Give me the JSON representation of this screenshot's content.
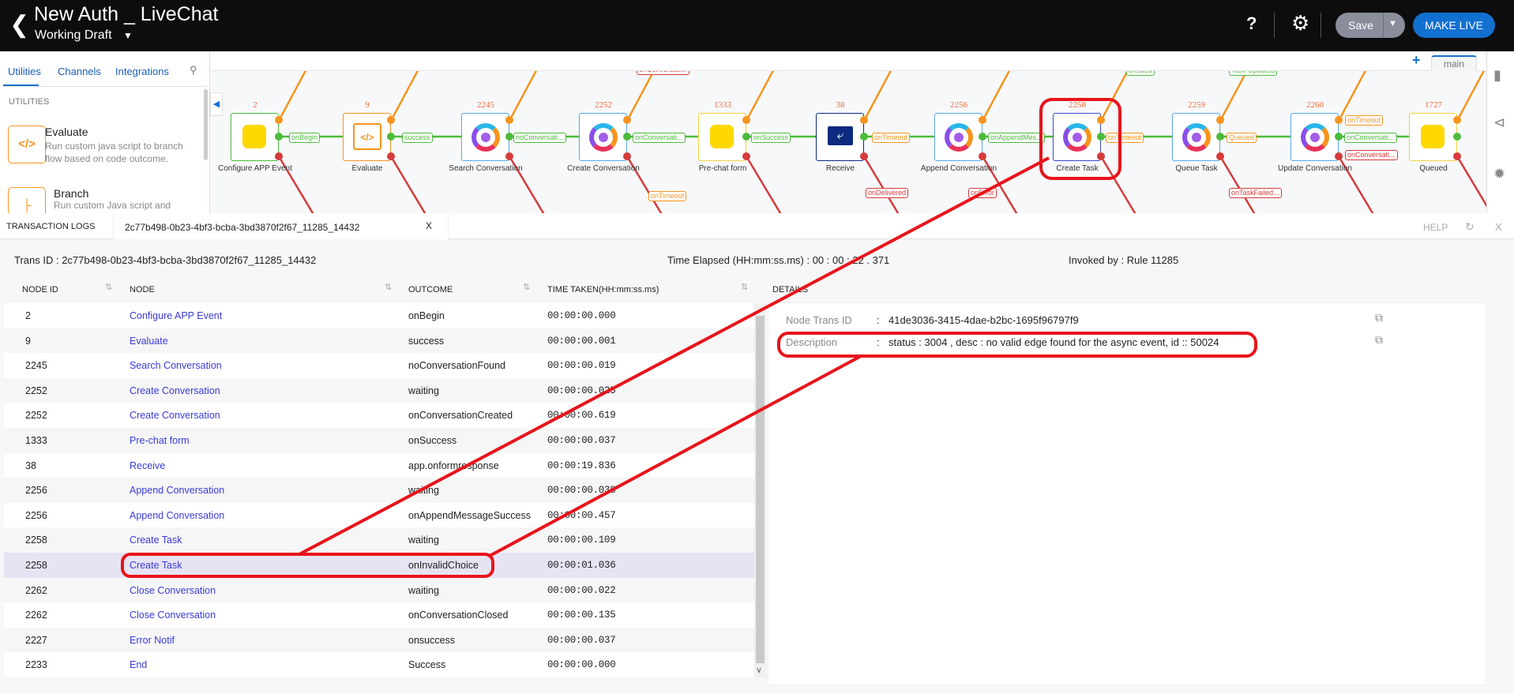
{
  "header": {
    "title": "New Auth _ LiveChat",
    "draft": "Working Draft",
    "save": "Save",
    "make_live": "MAKE LIVE",
    "help": "?"
  },
  "left_panel": {
    "tabs": [
      "Utilities",
      "Channels",
      "Integrations"
    ],
    "section": "UTILITIES",
    "items": [
      {
        "title": "Evaluate",
        "desc": "Run custom java script to branch flow based on code outcome.",
        "icon": "code-icon"
      },
      {
        "title": "Branch",
        "desc": "Run custom Java script and",
        "icon": "branch-icon"
      }
    ]
  },
  "canvas": {
    "tab": "main",
    "nodes": [
      {
        "id": "2",
        "label": "Configure APP Event",
        "type": "yellow",
        "border": "#4cbb3a"
      },
      {
        "id": "9",
        "label": "Evaluate",
        "type": "code",
        "border": "#f7941d"
      },
      {
        "id": "2245",
        "label": "Search Conversation",
        "type": "logo",
        "border": "#5aa9e6"
      },
      {
        "id": "2252",
        "label": "Create Conversation",
        "type": "logo",
        "border": "#5aa9e6"
      },
      {
        "id": "1333",
        "label": "Pre-chat form",
        "type": "yellow",
        "border": "#f5d33f"
      },
      {
        "id": "38",
        "label": "Receive",
        "type": "receive",
        "border": "#0b2a80"
      },
      {
        "id": "2256",
        "label": "Append Conversation",
        "type": "logo",
        "border": "#5aa9e6"
      },
      {
        "id": "2258",
        "label": "Create Task",
        "type": "logo",
        "border": "#3a4bd0"
      },
      {
        "id": "2259",
        "label": "Queue Task",
        "type": "logo",
        "border": "#5aa9e6"
      },
      {
        "id": "2260",
        "label": "Update Conversation",
        "type": "logo",
        "border": "#5aa9e6"
      },
      {
        "id": "1727",
        "label": "Queued",
        "type": "yellow",
        "border": "#f5d33f"
      }
    ],
    "edge_labels": [
      "onBegin",
      "success",
      "noConversati...",
      "onConversati...",
      "onSuccess",
      "onTimeout",
      "onAppendMes...",
      "onTimeout",
      "Queued",
      "onConversati...",
      "onTimeout",
      "onConversati...",
      "onConversati...",
      "created",
      "Task Updated",
      "onTimeout",
      "onDelivered",
      "onError",
      "onTaskFailed..."
    ],
    "colors": {
      "success": "#4cbb3a",
      "timeout": "#f7941d",
      "error": "#d63b3b"
    }
  },
  "logs": {
    "heading": "TRANSACTION LOGS",
    "tab": "2c77b498-0b23-4bf3-bcba-3bd3870f2f67_11285_14432",
    "help": "HELP",
    "trans_id": "Trans ID : 2c77b498-0b23-4bf3-bcba-3bd3870f2f67_11285_14432",
    "elapsed": "Time Elapsed (HH:mm:ss.ms) :  00 : 00 : 22 . 371",
    "invoked": "Invoked by : Rule 11285",
    "columns": [
      "NODE ID",
      "NODE",
      "OUTCOME",
      "TIME TAKEN(HH:mm:ss.ms)"
    ],
    "rows": [
      [
        "2",
        "Configure APP Event",
        "onBegin",
        "00:00:00.000"
      ],
      [
        "9",
        "Evaluate",
        "success",
        "00:00:00.001"
      ],
      [
        "2245",
        "Search Conversation",
        "noConversationFound",
        "00:00:00.019"
      ],
      [
        "2252",
        "Create Conversation",
        "waiting",
        "00:00:00.025"
      ],
      [
        "2252",
        "Create Conversation",
        "onConversationCreated",
        "00:00:00.619"
      ],
      [
        "1333",
        "Pre-chat form",
        "onSuccess",
        "00:00:00.037"
      ],
      [
        "38",
        "Receive",
        "app.onformresponse",
        "00:00:19.836"
      ],
      [
        "2256",
        "Append Conversation",
        "waiting",
        "00:00:00.038"
      ],
      [
        "2256",
        "Append Conversation",
        "onAppendMessageSuccess",
        "00:00:00.457"
      ],
      [
        "2258",
        "Create Task",
        "waiting",
        "00:00:00.109"
      ],
      [
        "2258",
        "Create Task",
        "onInvalidChoice",
        "00:00:01.036"
      ],
      [
        "2262",
        "Close Conversation",
        "waiting",
        "00:00:00.022"
      ],
      [
        "2262",
        "Close Conversation",
        "onConversationClosed",
        "00:00:00.135"
      ],
      [
        "2227",
        "Error Notif",
        "onsuccess",
        "00:00:00.037"
      ],
      [
        "2233",
        "End",
        "Success",
        "00:00:00.000"
      ]
    ],
    "selected_row": 10,
    "details": {
      "heading": "DETAILS",
      "node_trans_label": "Node Trans ID",
      "node_trans_value": "41de3036-3415-4dae-b2bc-1695f96797f9",
      "desc_label": "Description",
      "desc_value": "status : 3004 , desc : no valid edge found for the async event, id :: 50024",
      "colon": ":"
    }
  },
  "annotation_color": "#e8141c"
}
